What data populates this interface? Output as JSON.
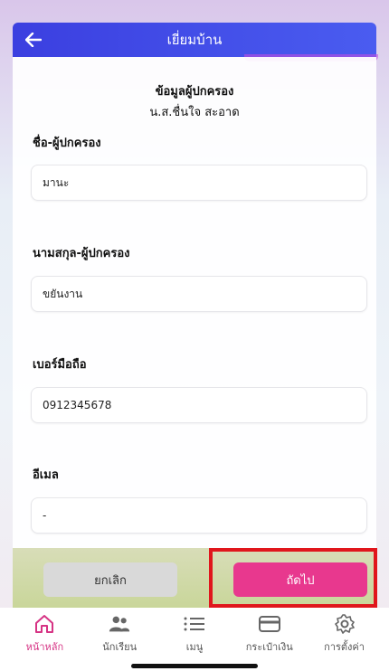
{
  "header": {
    "title": "เยี่ยมบ้าน"
  },
  "section": {
    "title": "ข้อมูลผู้ปกครอง",
    "student_name": "น.ส.ชื่นใจ สะอาด"
  },
  "fields": [
    {
      "label": "ชื่อ-ผู้ปกครอง",
      "value": "มานะ"
    },
    {
      "label": "นามสกุล-ผู้ปกครอง",
      "value": "ขยันงาน"
    },
    {
      "label": "เบอร์มือถือ",
      "value": "0912345678"
    },
    {
      "label": "อีเมล",
      "value": "-"
    }
  ],
  "actions": {
    "cancel_label": "ยกเลิก",
    "next_label": "ถัดไป"
  },
  "nav": {
    "items": [
      {
        "label": "หน้าหลัก",
        "icon": "home-icon",
        "active": true
      },
      {
        "label": "นักเรียน",
        "icon": "students-icon",
        "active": false
      },
      {
        "label": "เมนู",
        "icon": "menu-icon",
        "active": false
      },
      {
        "label": "กระเป๋าเงิน",
        "icon": "wallet-icon",
        "active": false
      },
      {
        "label": "การตั้งค่า",
        "icon": "settings-icon",
        "active": false
      }
    ]
  },
  "colors": {
    "header": "#3b3fe0",
    "accent": "#e8388e",
    "highlight": "#e0161c",
    "active_nav": "#d63384"
  }
}
